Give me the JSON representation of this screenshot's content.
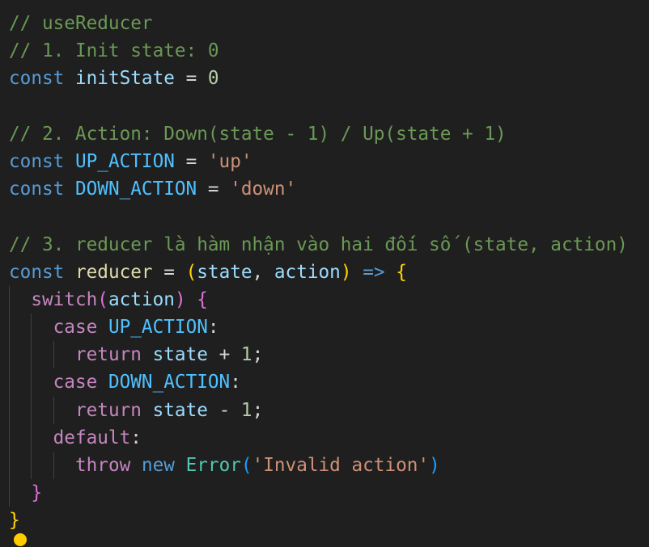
{
  "code": {
    "l1": "// useReducer",
    "l2": "// 1. Init state: 0",
    "l3_kw": "const",
    "l3_name": "initState",
    "l3_op": " = ",
    "l3_val": "0",
    "l5": "// 2. Action: Down(state - 1) / Up(state + 1)",
    "l6_kw": "const",
    "l6_name": "UP_ACTION",
    "l6_op": " = ",
    "l6_val": "'up'",
    "l7_kw": "const",
    "l7_name": "DOWN_ACTION",
    "l7_op": " = ",
    "l7_val": "'down'",
    "l9": "// 3. reducer là hàm nhận vào hai đối số (state, action)",
    "l10_kw": "const",
    "l10_name": "reducer",
    "l10_op": " = ",
    "l10_paren_open": "(",
    "l10_p1": "state",
    "l10_comma": ", ",
    "l10_p2": "action",
    "l10_paren_close": ")",
    "l10_arrow": "=>",
    "l10_brace": "{",
    "l11_kw": "switch",
    "l11_paren_open": "(",
    "l11_arg": "action",
    "l11_paren_close": ")",
    "l11_brace": "{",
    "l12_kw": "case",
    "l12_name": "UP_ACTION",
    "l12_colon": ":",
    "l13_kw": "return",
    "l13_var": "state",
    "l13_op": " + ",
    "l13_num": "1",
    "l13_semi": ";",
    "l14_kw": "case",
    "l14_name": "DOWN_ACTION",
    "l14_colon": ":",
    "l15_kw": "return",
    "l15_var": "state",
    "l15_op": " - ",
    "l15_num": "1",
    "l15_semi": ";",
    "l16_kw": "default",
    "l16_colon": ":",
    "l17_kw": "throw",
    "l17_new": "new",
    "l17_cls": "Error",
    "l17_paren_open": "(",
    "l17_str": "'Invalid action'",
    "l17_paren_close": ")",
    "l18_brace": "}",
    "l19_brace": "}"
  },
  "lightbulb_icon": "lightbulb-icon",
  "colors": {
    "background": "#1f1f1f",
    "comment": "#6a9955",
    "keyword": "#569cd6",
    "control": "#c586c0",
    "variable": "#9cdcfe",
    "constant": "#4fc1ff",
    "number": "#b5cea8",
    "string": "#ce9178",
    "class": "#4ec9b0",
    "bracket_level1": "#ffd700",
    "bracket_level2": "#da70d6",
    "bracket_level3": "#179fff"
  }
}
